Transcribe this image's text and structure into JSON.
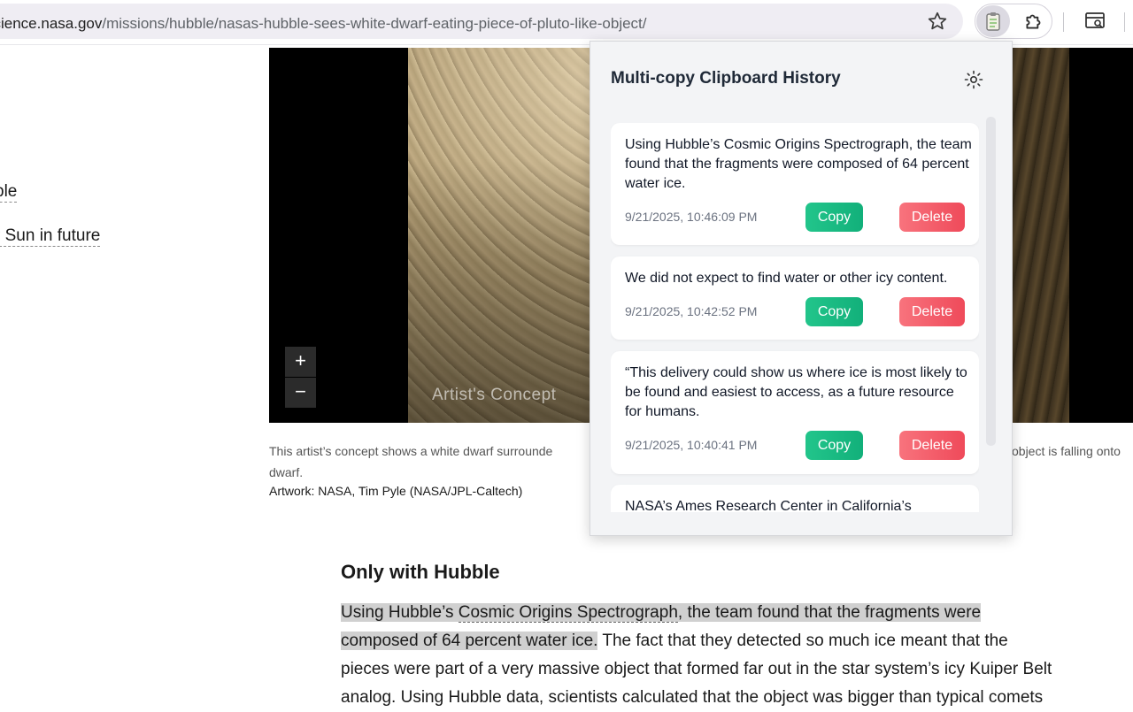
{
  "browser": {
    "url_host": "science.nasa.gov",
    "url_path": "/missions/hubble/nasas-hubble-sees-white-dwarf-eating-piece-of-pluto-like-object/"
  },
  "sidebar": {
    "link1": "ble",
    "link2": "r Sun in future"
  },
  "media": {
    "overlay_text": "Artist's Concept",
    "zoom_in": "+",
    "zoom_out": "−"
  },
  "figure": {
    "caption_left": "This artist’s concept shows a white dwarf surrounde",
    "caption_right": "object is falling onto",
    "caption_line2": "dwarf.",
    "credit": "Artwork: NASA, Tim Pyle (NASA/JPL-Caltech)"
  },
  "article": {
    "heading": "Only with Hubble",
    "p_hl_a": "Using Hubble’s ",
    "p_link": "Cosmic Origins Spectrograph",
    "p_hl_b": ", the team found that the fragments were",
    "p_hl_c": "composed of 64 percent water ice.",
    "p_rest1": " The fact that they detected so much ice meant that the",
    "p_line3": "pieces were part of a very massive object that formed far out in the star system’s icy Kuiper Belt",
    "p_line4": "analog. Using Hubble data, scientists calculated that the object was bigger than typical comets"
  },
  "popup": {
    "title": "Multi-copy Clipboard History",
    "copy_label": "Copy",
    "delete_label": "Delete",
    "entries": [
      {
        "text": "Using Hubble’s Cosmic Origins Spectrograph, the team found that the fragments were composed of 64 percent water ice.",
        "time": "9/21/2025, 10:46:09 PM"
      },
      {
        "text": "We did not expect to find water or other icy content.",
        "time": "9/21/2025, 10:42:52 PM"
      },
      {
        "text": " “This delivery could show us where ice is most likely to be found and easiest to access, as a future resource for humans.",
        "time": "9/21/2025, 10:40:41 PM"
      },
      {
        "text": "NASA’s Ames Research Center in California’s",
        "time": ""
      }
    ]
  }
}
